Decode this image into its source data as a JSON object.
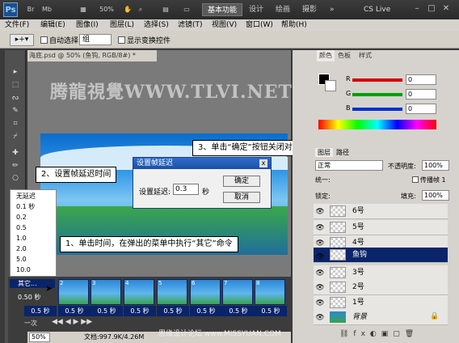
{
  "titlebar": {
    "logo": "Ps",
    "zoom": "50%",
    "workspaces": [
      "基本功能",
      "设计",
      "绘画",
      "摄影"
    ],
    "more": "»",
    "cs_live": "CS Live",
    "win_min": "–",
    "win_max": "□",
    "win_close": "✕"
  },
  "menubar": {
    "items": [
      "文件(F)",
      "编辑(E)",
      "图像(I)",
      "图层(L)",
      "选择(S)",
      "滤镜(T)",
      "视图(V)",
      "窗口(W)",
      "帮助(H)"
    ]
  },
  "options": {
    "auto_select_label": "自动选择:",
    "auto_select_value": "组",
    "show_transform_label": "显示变换控件"
  },
  "document": {
    "tab_title": "海底.psd @ 50% (鱼钩, RGB/8#) *",
    "watermark": "腾龍視覺WWW.TLVI.NET"
  },
  "callouts": {
    "step1": "1、单击时间，在弹出的菜单中执行“其它”命令",
    "step2": "2、设置帧延迟时间",
    "step3": "3、单击“确定”按钮关闭对话框"
  },
  "dialog": {
    "title": "设置帧延迟",
    "close": "x",
    "label": "设置延迟:",
    "value": "0.3",
    "unit": "秒",
    "ok": "确定",
    "cancel": "取消"
  },
  "delay_menu": {
    "items": [
      "无延迟",
      "0.1 秒",
      "0.2",
      "0.5",
      "1.0",
      "2.0",
      "5.0",
      "10.0"
    ],
    "other": "其它...",
    "current": "0.50 秒"
  },
  "animation": {
    "frames": [
      "2",
      "3",
      "4",
      "5",
      "6",
      "7",
      "8"
    ],
    "frame_delays": [
      "0.5 秒",
      "0.5 秒",
      "0.5 秒",
      "0.5 秒",
      "0.5 秒",
      "0.5 秒",
      "0.5 秒",
      "0.5 秒"
    ],
    "loop": "一次"
  },
  "statusbar": {
    "zoom": "50%",
    "doc": "文档:997.9K/4.26M"
  },
  "color_panel": {
    "tabs": [
      "颜色",
      "色板",
      "样式"
    ],
    "labels": [
      "R",
      "G",
      "B"
    ],
    "values": [
      "0",
      "0",
      "0"
    ],
    "colors": {
      "r": "#d40000",
      "g": "#00a000",
      "b": "#0030d0"
    }
  },
  "layers_panel": {
    "tabs": [
      "图层",
      "路径"
    ],
    "blend_mode": "正常",
    "opacity_label": "不透明度:",
    "opacity_value": "100%",
    "unify_label": "统一:",
    "propagate_label": "传播帧 1",
    "lock_label": "锁定:",
    "fill_label": "填充:",
    "fill_value": "100%",
    "layers": [
      "6号",
      "5号",
      "4号",
      "鱼钩",
      "3号",
      "2号",
      "1号",
      "背景"
    ]
  },
  "bottom_watermark": "思缘设计论坛 www.MISSYUAN.COM"
}
